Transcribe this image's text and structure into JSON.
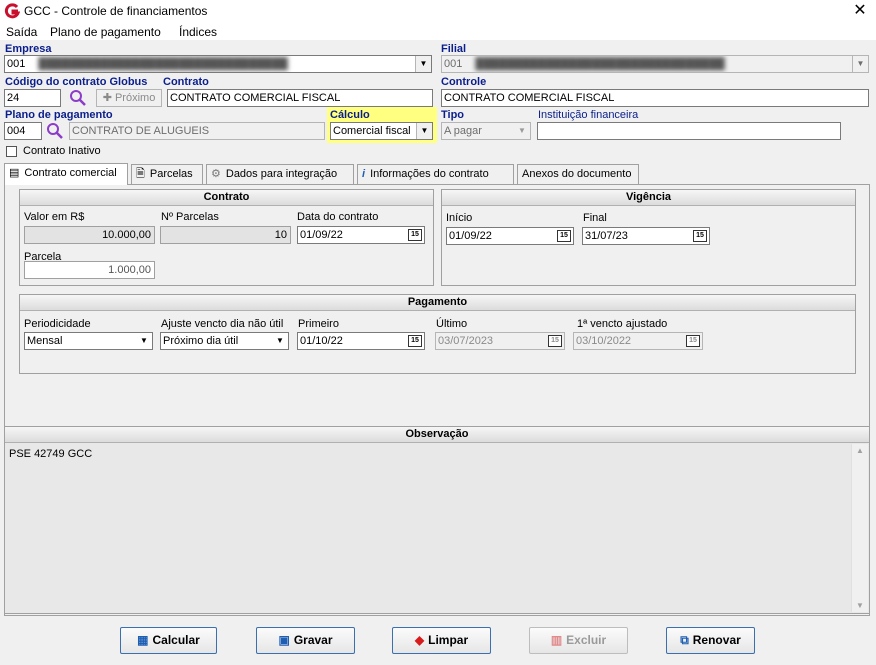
{
  "window": {
    "title": "GCC - Controle de financiamentos",
    "close": "✕"
  },
  "menu": [
    "Saída",
    "Plano de pagamento",
    "Índices"
  ],
  "fields": {
    "empresa_label": "Empresa",
    "empresa_value": "001",
    "filial_label": "Filial",
    "filial_value": "001",
    "codigo_label": "Código do contrato Globus",
    "codigo_value": "24",
    "proximo_label": "Próximo",
    "contrato_label": "Contrato",
    "contrato_value": "CONTRATO COMERCIAL FISCAL",
    "controle_label": "Controle",
    "controle_value": "CONTRATO COMERCIAL FISCAL",
    "plano_label": "Plano de pagamento",
    "plano_code": "004",
    "plano_value": "CONTRATO DE ALUGUEIS",
    "calculo_label": "Cálculo",
    "calculo_value": "Comercial fiscal",
    "tipo_label": "Tipo",
    "tipo_value": "A pagar",
    "instituicao_label": "Instituição financeira",
    "instituicao_value": "",
    "inativo_label": "Contrato Inativo"
  },
  "tabs": [
    {
      "label": "Contrato comercial",
      "icon": "form-icon"
    },
    {
      "label": "Parcelas",
      "icon": "document-icon"
    },
    {
      "label": "Dados para integração",
      "icon": "gear-icon"
    },
    {
      "label": "Informações do contrato",
      "icon": "info-icon"
    },
    {
      "label": "Anexos do documento",
      "icon": ""
    }
  ],
  "contrato_panel": {
    "title": "Contrato",
    "valor_label": "Valor em R$",
    "valor_value": "10.000,00",
    "nparcelas_label": "Nº Parcelas",
    "nparcelas_value": "10",
    "data_label": "Data do contrato",
    "data_value": "01/09/22",
    "parcela_label": "Parcela",
    "parcela_value": "1.000,00"
  },
  "vigencia_panel": {
    "title": "Vigência",
    "inicio_label": "Início",
    "inicio_value": "01/09/22",
    "final_label": "Final",
    "final_value": "31/07/23"
  },
  "pagamento_panel": {
    "title": "Pagamento",
    "periodicidade_label": "Periodicidade",
    "periodicidade_value": "Mensal",
    "ajuste_label": "Ajuste vencto dia não útil",
    "ajuste_value": "Próximo dia útil",
    "primeiro_label": "Primeiro",
    "primeiro_value": "01/10/22",
    "ultimo_label": "Último",
    "ultimo_value": "03/07/2023",
    "vencto_label": "1ª vencto ajustado",
    "vencto_value": "03/10/2022"
  },
  "observacao": {
    "title": "Observação",
    "text": "PSE 42749 GCC"
  },
  "calendar_glyph": "15",
  "buttons": {
    "calcular": "Calcular",
    "gravar": "Gravar",
    "limpar": "Limpar",
    "excluir": "Excluir",
    "renovar": "Renovar"
  },
  "colors": {
    "highlight": "#ffff80",
    "label_blue": "#0a1e8c",
    "button_border": "#3a6fb0"
  }
}
